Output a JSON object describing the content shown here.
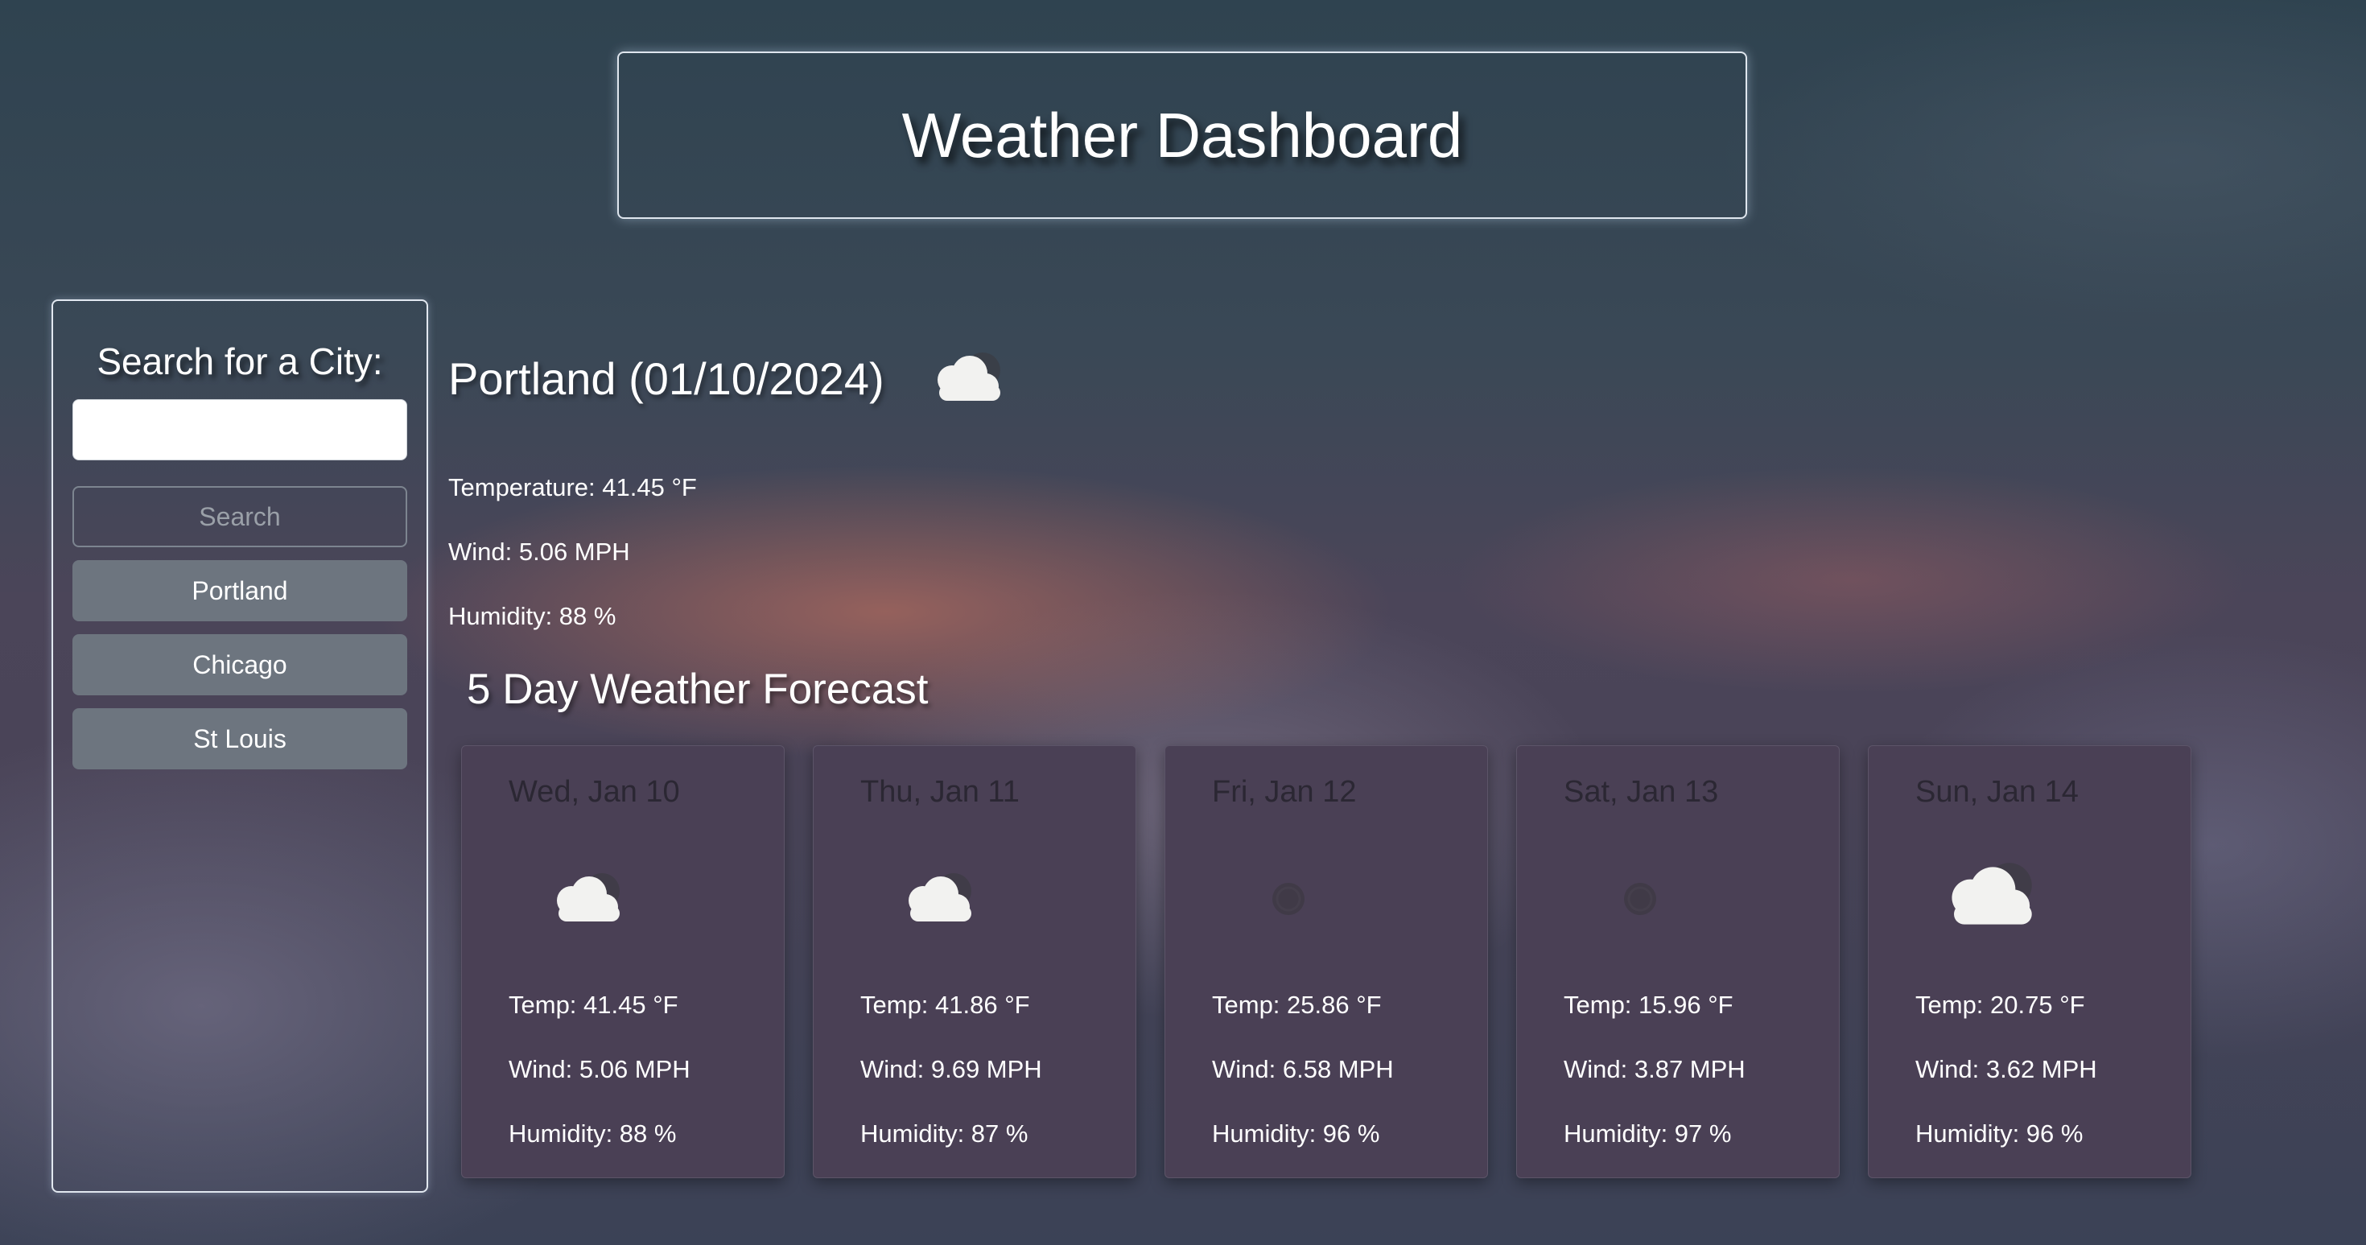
{
  "header": {
    "title": "Weather Dashboard"
  },
  "sidebar": {
    "title": "Search for a City:",
    "search_value": "",
    "search_button": "Search",
    "history": [
      {
        "label": "Portland"
      },
      {
        "label": "Chicago"
      },
      {
        "label": "St Louis"
      }
    ]
  },
  "current": {
    "title": "Portland (01/10/2024)",
    "icon": "cloud-icon",
    "temperature": "Temperature: 41.45 °F",
    "wind": "Wind: 5.06 MPH",
    "humidity": "Humidity: 88 %"
  },
  "forecast": {
    "title": "5 Day Weather Forecast",
    "days": [
      {
        "date": "Wed, Jan 10",
        "icon": "cloud-icon",
        "temp": "Temp: 41.45 °F",
        "wind": "Wind: 5.06 MPH",
        "humidity": "Humidity: 88 %"
      },
      {
        "date": "Thu, Jan 11",
        "icon": "cloud-icon",
        "temp": "Temp: 41.86 °F",
        "wind": "Wind: 9.69 MPH",
        "humidity": "Humidity: 87 %"
      },
      {
        "date": "Fri, Jan 12",
        "icon": "moon-icon",
        "temp": "Temp: 25.86 °F",
        "wind": "Wind: 6.58 MPH",
        "humidity": "Humidity: 96 %"
      },
      {
        "date": "Sat, Jan 13",
        "icon": "moon-icon",
        "temp": "Temp: 15.96 °F",
        "wind": "Wind: 3.87 MPH",
        "humidity": "Humidity: 97 %"
      },
      {
        "date": "Sun, Jan 14",
        "icon": "cloud-icon",
        "temp": "Temp: 20.75 °F",
        "wind": "Wind: 3.62 MPH",
        "humidity": "Humidity: 96 %"
      }
    ]
  }
}
